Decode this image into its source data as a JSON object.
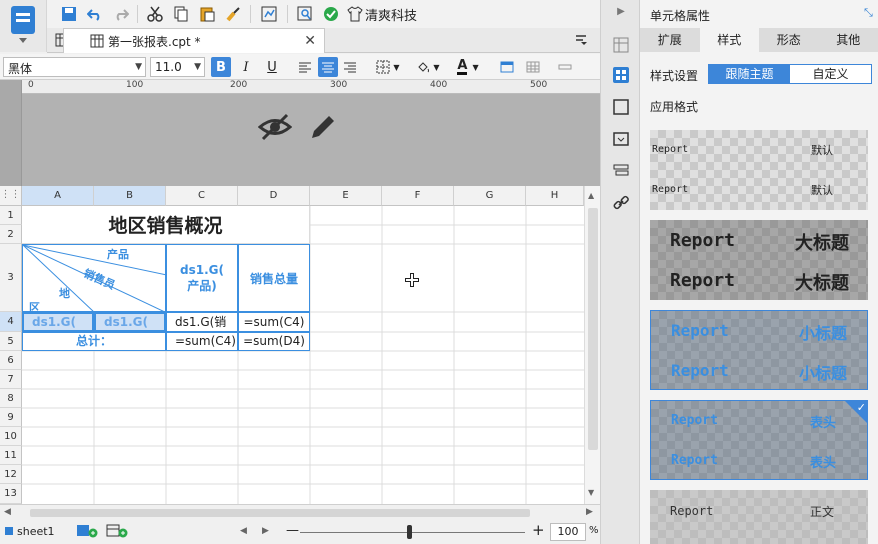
{
  "toolbar": {
    "brand_label": "清爽科技"
  },
  "tab": {
    "title": "第一张报表.cpt *",
    "close": "✕"
  },
  "format": {
    "font_family": "黑体",
    "font_size": "11.0",
    "bold": "B",
    "italic": "I",
    "underline": "U",
    "font_color": "A"
  },
  "ruler": {
    "ticks": [
      "0",
      "100",
      "200",
      "300",
      "400",
      "500"
    ]
  },
  "columns": [
    "A",
    "B",
    "C",
    "D",
    "E",
    "F",
    "G",
    "H"
  ],
  "rows": [
    "1",
    "2",
    "3",
    "4",
    "5",
    "6",
    "7",
    "8",
    "9",
    "10",
    "11",
    "12",
    "13"
  ],
  "sheet": {
    "title": "地区销售概况",
    "header_product": "产品",
    "header_salesperson": "销售员",
    "header_region_1": "地",
    "header_region_2": "区",
    "c3": "ds1.G(\n产品)",
    "d3": "销售总量",
    "a4": "ds1.G(",
    "b4": "ds1.G(",
    "c4": "ds1.G(销",
    "d4": "=sum(C4)",
    "ab5": "总计：",
    "c5": "=sum(C4)",
    "d5": "=sum(D4)"
  },
  "bottom": {
    "sheet_name": "sheet1",
    "zoom": "100",
    "zoom_pct": "%",
    "minus": "—",
    "plus": "+"
  },
  "panel": {
    "title": "单元格属性",
    "tabs": [
      "扩展",
      "样式",
      "形态",
      "其他"
    ],
    "style_settings_label": "样式设置",
    "follow_theme": "跟随主题",
    "custom": "自定义",
    "apply_format_label": "应用格式",
    "cards": [
      {
        "left": "Report",
        "right": "默认"
      },
      {
        "left": "Report",
        "right": "大标题"
      },
      {
        "left": "Report",
        "right": "小标题"
      },
      {
        "left": "Report",
        "right": "表头"
      },
      {
        "left": "Report",
        "right": "正文"
      }
    ]
  },
  "colors": {
    "accent": "#3d86d9",
    "cell_blue": "#3b8fe0"
  }
}
